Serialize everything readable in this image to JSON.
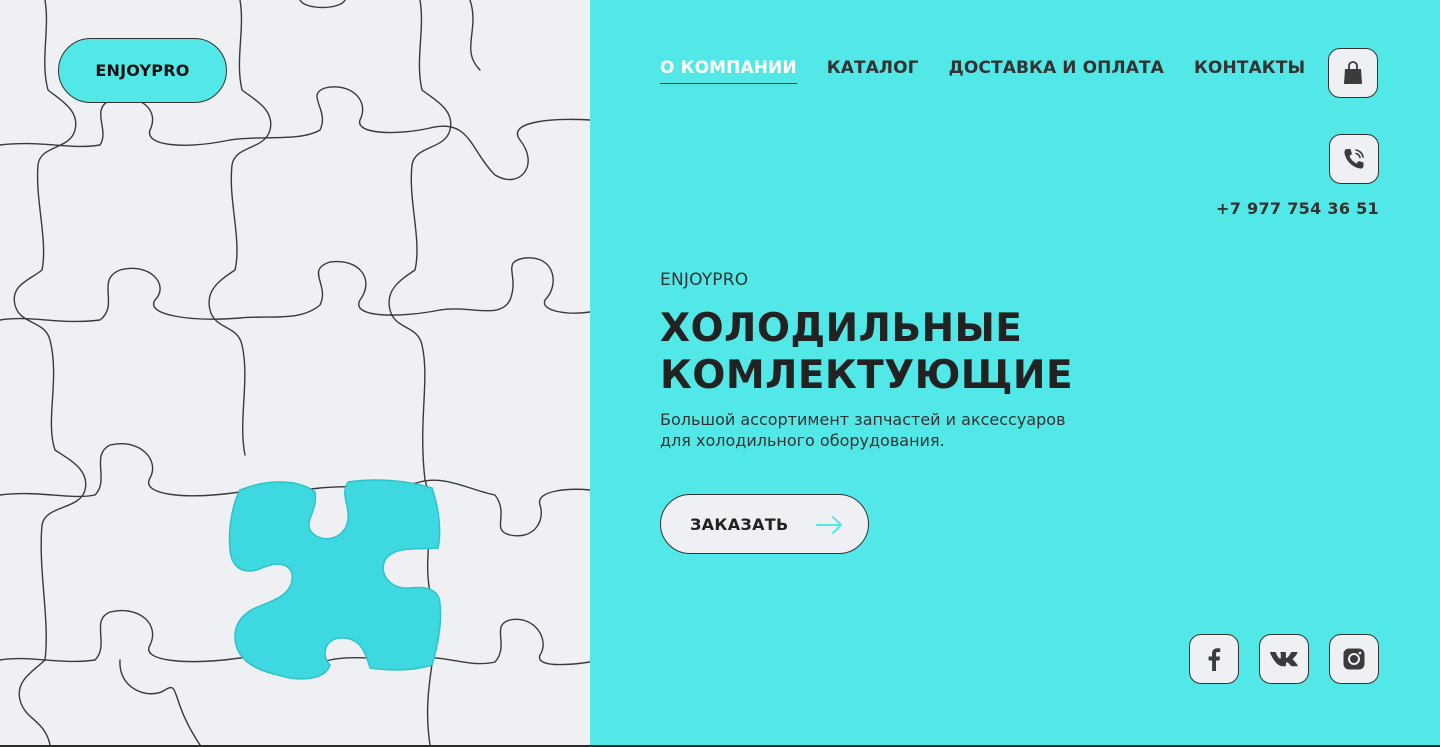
{
  "brand": {
    "logo_text": "ENJOYPRO"
  },
  "nav": {
    "items": [
      {
        "label": "О КОМПАНИИ",
        "active": true
      },
      {
        "label": "КАТАЛОГ",
        "active": false
      },
      {
        "label": "ДОСТАВКА И ОПЛАТА",
        "active": false
      },
      {
        "label": "КОНТАКТЫ",
        "active": false
      }
    ]
  },
  "header": {
    "cart_icon": "shopping-bag-icon",
    "phone_icon": "phone-icon",
    "phone_number": "+7 977 754 36 51"
  },
  "hero": {
    "eyebrow": "ENJOYPRO",
    "title_line1": "ХОЛОДИЛЬНЫЕ",
    "title_line2": "КОМЛЕКТУЮЩИЕ",
    "subtitle_line1": "Большой ассортимент запчастей и аксессуаров",
    "subtitle_line2": "для холодильного оборудования.",
    "cta_label": "ЗАКАЗАТЬ",
    "cta_icon": "arrow-right-icon"
  },
  "social": {
    "items": [
      "facebook-icon",
      "vk-icon",
      "instagram-icon"
    ]
  },
  "colors": {
    "accent": "#53e8e8",
    "light": "#eef0f3",
    "dark_text": "#222222"
  }
}
